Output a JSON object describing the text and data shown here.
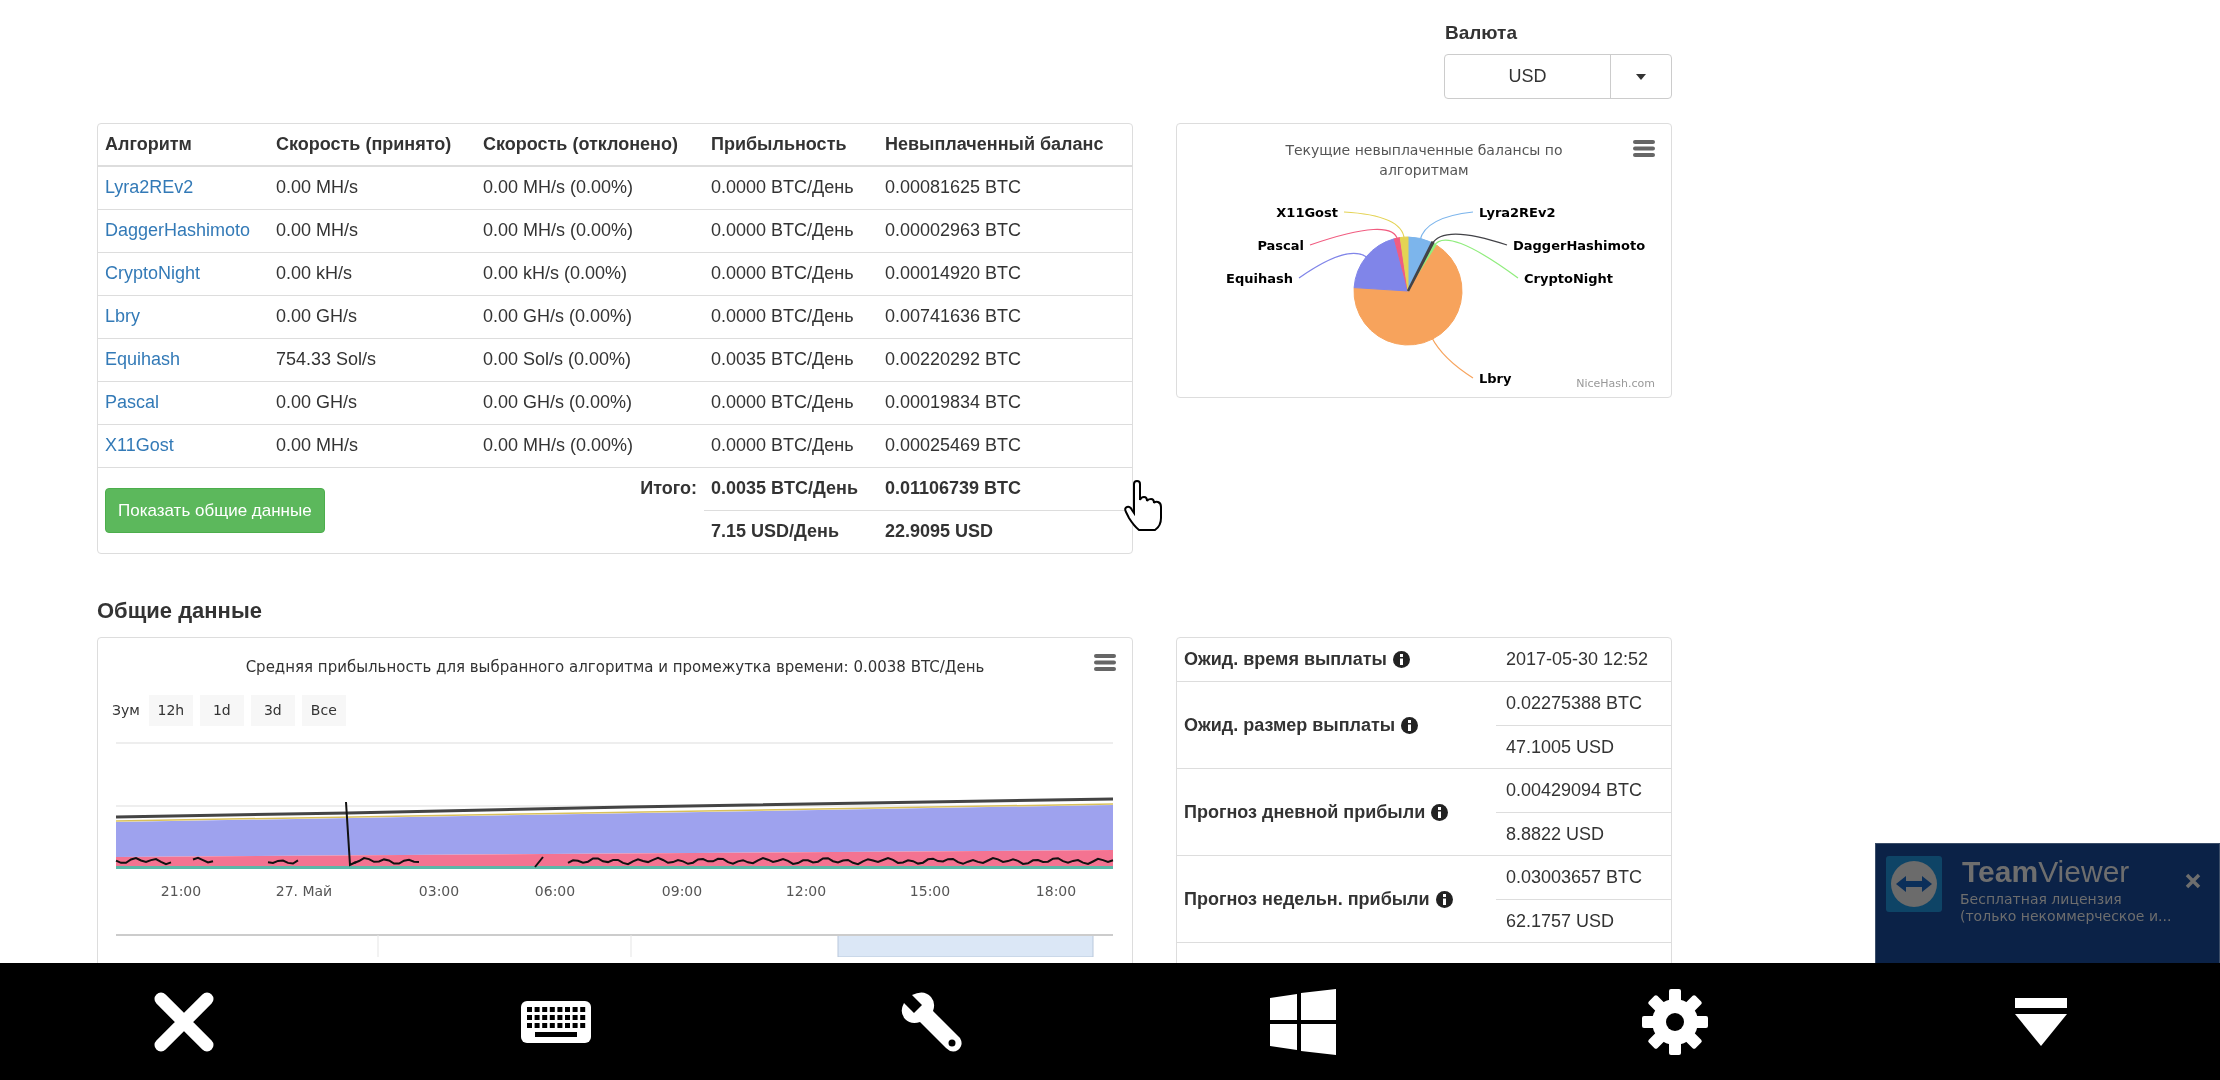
{
  "currency": {
    "label": "Валюта",
    "value": "USD"
  },
  "algorithms_table": {
    "columns": [
      "Алгоритм",
      "Скорость (принято)",
      "Скорость (отклонено)",
      "Прибыльность",
      "Невыплаченный баланс"
    ],
    "rows": [
      {
        "algorithm": "Lyra2REv2",
        "speed_accepted": "0.00 MH/s",
        "speed_rejected": "0.00 MH/s (0.00%)",
        "profitability": "0.0000 BTC/День",
        "balance": "0.00081625 BTC"
      },
      {
        "algorithm": "DaggerHashimoto",
        "speed_accepted": "0.00 MH/s",
        "speed_rejected": "0.00 MH/s (0.00%)",
        "profitability": "0.0000 BTC/День",
        "balance": "0.00002963 BTC"
      },
      {
        "algorithm": "CryptoNight",
        "speed_accepted": "0.00 kH/s",
        "speed_rejected": "0.00 kH/s (0.00%)",
        "profitability": "0.0000 BTC/День",
        "balance": "0.00014920 BTC"
      },
      {
        "algorithm": "Lbry",
        "speed_accepted": "0.00 GH/s",
        "speed_rejected": "0.00 GH/s (0.00%)",
        "profitability": "0.0000 BTC/День",
        "balance": "0.00741636 BTC"
      },
      {
        "algorithm": "Equihash",
        "speed_accepted": "754.33 Sol/s",
        "speed_rejected": "0.00 Sol/s (0.00%)",
        "profitability": "0.0035 BTC/День",
        "balance": "0.00220292 BTC"
      },
      {
        "algorithm": "Pascal",
        "speed_accepted": "0.00 GH/s",
        "speed_rejected": "0.00 GH/s (0.00%)",
        "profitability": "0.0000 BTC/День",
        "balance": "0.00019834 BTC"
      },
      {
        "algorithm": "X11Gost",
        "speed_accepted": "0.00 MH/s",
        "speed_rejected": "0.00 MH/s (0.00%)",
        "profitability": "0.0000 BTC/День",
        "balance": "0.00025469 BTC"
      }
    ],
    "show_button": "Показать общие данные",
    "total_label": "Итого:",
    "totals": [
      [
        "0.0035 BTC/День",
        "0.01106739 BTC"
      ],
      [
        "7.15 USD/День",
        "22.9095 USD"
      ]
    ]
  },
  "balance_chart": {
    "title": "Текущие невыплаченные балансы по алгоритмам",
    "credit": "NiceHash.com",
    "labels": [
      {
        "text": "X11Gost",
        "color": "#e4d354"
      },
      {
        "text": "Lyra2REv2",
        "color": "#7cb5ec"
      },
      {
        "text": "Pascal",
        "color": "#f15c80"
      },
      {
        "text": "DaggerHashimoto",
        "color": "#434348"
      },
      {
        "text": "Equihash",
        "color": "#8085e9"
      },
      {
        "text": "CryptoNight",
        "color": "#90ed7d"
      },
      {
        "text": "Lbry",
        "color": "#f7a35c"
      }
    ]
  },
  "section_title": "Общие данные",
  "profit_chart": {
    "title": "Средняя прибыльность для выбранного алгоритма и промежутка времени: 0.0038 BTC/День",
    "zoom_label": "Зум",
    "zoom_buttons": [
      "12h",
      "1d",
      "3d",
      "Все"
    ],
    "x_labels": [
      "21:00",
      "27. Май",
      "03:00",
      "06:00",
      "09:00",
      "12:00",
      "15:00",
      "18:00"
    ]
  },
  "payout_table": {
    "rows": [
      {
        "label": "Ожид. время выплаты",
        "values": [
          "2017-05-30 12:52"
        ]
      },
      {
        "label": "Ожид. размер выплаты",
        "values": [
          "0.02275388 BTC",
          "47.1005 USD"
        ]
      },
      {
        "label": "Прогноз дневной прибыли",
        "values": [
          "0.00429094 BTC",
          "8.8822 USD"
        ]
      },
      {
        "label": "Прогноз недельн. прибыли",
        "values": [
          "0.03003657 BTC",
          "62.1757 USD"
        ]
      }
    ]
  },
  "teamviewer": {
    "title": "**Team**Viewer",
    "subtitle": [
      "Бесплатная лицензия",
      "(только некоммерческое и..."
    ]
  }
}
